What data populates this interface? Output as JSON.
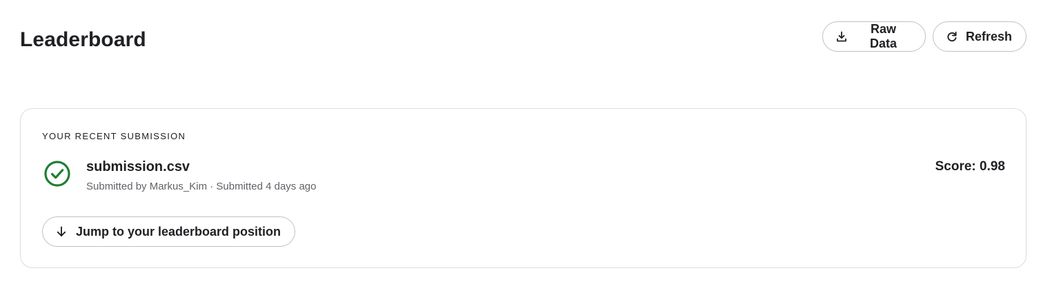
{
  "header": {
    "title": "Leaderboard",
    "raw_data_label": "Raw Data",
    "refresh_label": "Refresh"
  },
  "recent_submission": {
    "section_label": "YOUR RECENT SUBMISSION",
    "file_name": "submission.csv",
    "meta": "Submitted by Markus_Kim · Submitted 4 days ago",
    "score": "Score: 0.98",
    "status": "success",
    "status_icon": "check-circle-icon",
    "jump_label": "Jump to your leaderboard position"
  },
  "colors": {
    "success": "#1e7e34",
    "text": "#202124",
    "muted": "#5f6368",
    "border": "#dadce0"
  }
}
